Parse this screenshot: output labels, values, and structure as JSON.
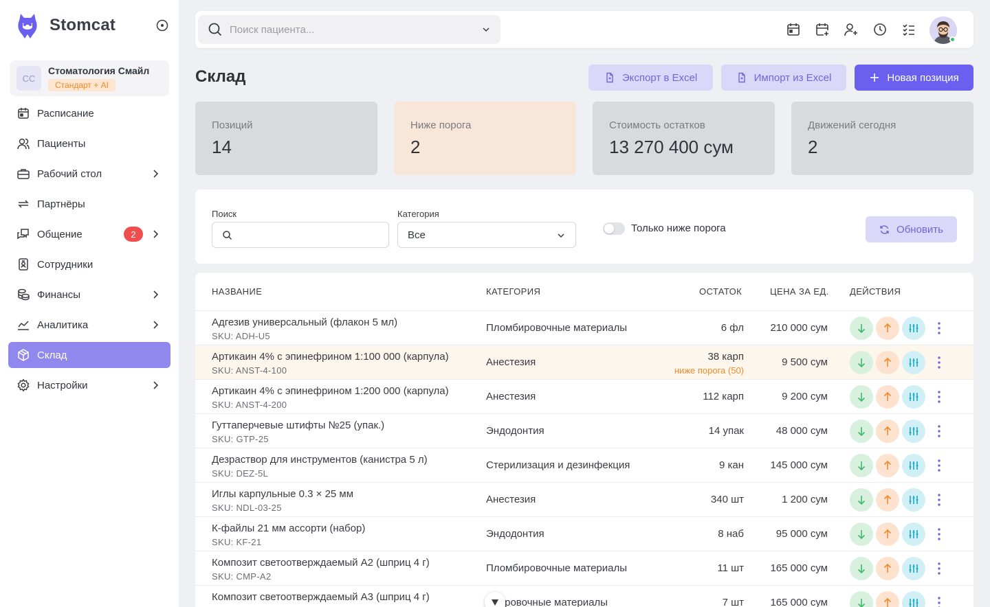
{
  "brand": {
    "name": "Stomcat"
  },
  "clinic": {
    "initials": "СС",
    "name": "Стоматология Смайл",
    "plan": "Стандарт + AI"
  },
  "nav": {
    "schedule": "Расписание",
    "patients": "Пациенты",
    "desktop": "Рабочий стол",
    "partners": "Партнёры",
    "chat": "Общение",
    "chat_badge": "2",
    "staff": "Сотрудники",
    "finance": "Финансы",
    "analytics": "Аналитика",
    "warehouse": "Склад",
    "settings": "Настройки",
    "active": "warehouse"
  },
  "topbar": {
    "search_placeholder": "Поиск пациента..."
  },
  "page": {
    "title": "Склад",
    "export_label": "Экспорт в Excel",
    "import_label": "Импорт из Excel",
    "new_label": "Новая позиция"
  },
  "stats": [
    {
      "label": "Позиций",
      "value": "14"
    },
    {
      "label": "Ниже порога",
      "value": "2"
    },
    {
      "label": "Стоимость остатков",
      "value": "13 270 400 сум"
    },
    {
      "label": "Движений сегодня",
      "value": "2"
    }
  ],
  "filters": {
    "search_label": "Поиск",
    "search_value": "",
    "category_label": "Категория",
    "category_value": "Все",
    "toggle_label": "Только ниже порога",
    "toggle_on": false,
    "refresh_label": "Обновить"
  },
  "table": {
    "headers": {
      "name": "НАЗВАНИЕ",
      "category": "КАТЕГОРИЯ",
      "stock": "ОСТАТОК",
      "price": "ЦЕНА ЗА ЕД.",
      "actions": "ДЕЙСТВИЯ"
    },
    "rows": [
      {
        "name": "Адгезив универсальный (флакон 5 мл)",
        "sku": "SKU: ADH-U5",
        "category": "Пломбировочные материалы",
        "stock": "6 фл",
        "warn": "",
        "price": "210 000 сум"
      },
      {
        "name": "Артикаин 4% с эпинефрином 1:100 000 (карпула)",
        "sku": "SKU: ANST-4-100",
        "category": "Анестезия",
        "stock": "38 карп",
        "warn": "ниже порога (50)",
        "price": "9 500 сум"
      },
      {
        "name": "Артикаин 4% с эпинефрином 1:200 000 (карпула)",
        "sku": "SKU: ANST-4-200",
        "category": "Анестезия",
        "stock": "112 карп",
        "warn": "",
        "price": "9 200 сум"
      },
      {
        "name": "Гуттаперчевые штифты №25 (упак.)",
        "sku": "SKU: GTP-25",
        "category": "Эндодонтия",
        "stock": "14 упак",
        "warn": "",
        "price": "48 000 сум"
      },
      {
        "name": "Дезраствор для инструментов (канистра 5 л)",
        "sku": "SKU: DEZ-5L",
        "category": "Стерилизация и дезинфекция",
        "stock": "9 кан",
        "warn": "",
        "price": "145 000 сум"
      },
      {
        "name": "Иглы карпульные 0.3 × 25 мм",
        "sku": "SKU: NDL-03-25",
        "category": "Анестезия",
        "stock": "340 шт",
        "warn": "",
        "price": "1 200 сум"
      },
      {
        "name": "К-файлы 21 мм ассорти (набор)",
        "sku": "SKU: KF-21",
        "category": "Эндодонтия",
        "stock": "8 наб",
        "warn": "",
        "price": "95 000 сум"
      },
      {
        "name": "Композит светоотверждаемый A2 (шприц 4 г)",
        "sku": "SKU: CMP-A2",
        "category": "Пломбировочные материалы",
        "stock": "11 шт",
        "warn": "",
        "price": "165 000 сум"
      },
      {
        "name": "Композит светоотверждаемый A3 (шприц 4 г)",
        "sku": "",
        "category": "мбировочные материалы",
        "stock": "7 шт",
        "warn": "",
        "price": "165 000 сум"
      }
    ]
  },
  "colors": {
    "accent": "#6b5ff0",
    "accent_soft": "#dad8f8",
    "nav_active": "#9088ec",
    "warning": "#f08a2c",
    "badge": "#f04e4e",
    "online": "#2ec46a"
  },
  "icons": {
    "topbar": [
      "calendar-icon",
      "calendar-add-icon",
      "user-add-icon",
      "clock-icon",
      "checklist-icon"
    ],
    "row_actions": [
      "arrow-down-icon",
      "arrow-up-icon",
      "sliders-icon",
      "more-vertical-icon"
    ]
  }
}
